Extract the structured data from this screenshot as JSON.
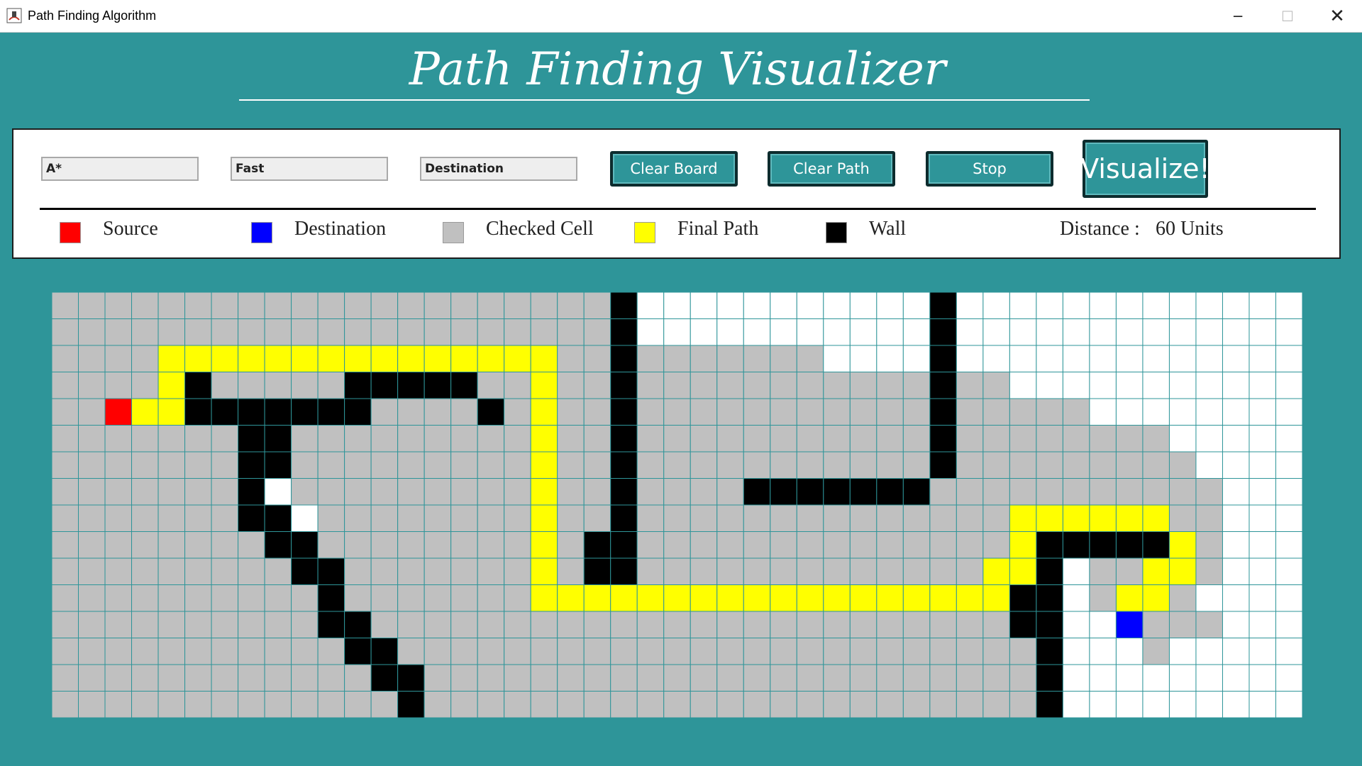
{
  "window": {
    "title": "Path Finding Algorithm",
    "controls": {
      "minimize": "─",
      "maximize": "☐",
      "close": "✕"
    }
  },
  "header": {
    "title": "Path Finding Visualizer"
  },
  "controls": {
    "algorithm": "A*",
    "speed": "Fast",
    "mode": "Destination",
    "clear_board": "Clear Board",
    "clear_path": "Clear Path",
    "stop": "Stop",
    "visualize": "Visualize!"
  },
  "legend": {
    "source": "Source",
    "destination": "Destination",
    "checked": "Checked Cell",
    "final_path": "Final Path",
    "wall": "Wall",
    "distance_label": "Distance :",
    "distance_value": "60 Units"
  },
  "colors": {
    "background": "#2e9599",
    "source": "#ff0000",
    "destination": "#0000ff",
    "checked": "#c0c0c0",
    "path": "#ffff00",
    "wall": "#000000",
    "empty": "#ffffff",
    "gridline": "#2e9599"
  },
  "grid": {
    "cols": 47,
    "rows": 16,
    "rows_data": [
      "CCCCCCCCCCCCCCCCCCCCCWEEEEEEEEEEEWEEEEEEEEEEEEEEE",
      "CCCCCCCCCCCCCCCCCCCCCWEEEEEEEEEEEWEEEEEEEEEEEEEEE",
      "CCCCPPPPPPPPPPPPPPPCCWCCCCCCCEEEEWEEEEEEEEEEEEEEE",
      "CCCCPWCCCCCWWWWWCCPCCWCCCCCCCCCCCWCCEEEEEEEEEEEEE",
      "CCSPPWWWWWWWCCCCWCPCCWCCCCCCCCCCCWCCCCCEEEEEEEEEE",
      "CCCCCCCWWCCCCCCCCCPCCWCCCCCCCCCCCWCCCCCCCCEEEEEEE",
      "CCCCCCCWWCCCCCCCCCPCCWCCCCCCCCCCCWCCCCCCCCCEEEEEE",
      "CCCCCCCWECCCCCCCCCPCCWCCCCWWWWWWWCCCCCCCCCCCEEEEE",
      "CCCCCCCWWECCCCCCCCPCCWCCCCCCCCCCCCCCPPPPPPCCEEEEE",
      "CCCCCCCCWWCCCCCCCCPCWWCCCCCCCCCCCCCCPWWWWWPCEEEEE",
      "CCCCCCCCCWWCCCCCCCPCWWCCCCCCCCCCCCCPPWECCPPCEEEEE",
      "CCCCCCCCCCWCCCCCCCPPPPPPPPPPPPPPPPPPWWECPPCEEEEEE",
      "CCCCCCCCCCWWCCCCCCCCCCCCCCCCCCCCCCCCWWEEDCCCEEEEE",
      "CCCCCCCCCCCWWCCCCCCCCCCCCCCCCCCCCCCCCWEEECEEEEEEE",
      "CCCCCCCCCCCCWWCCCCCCCCCCCCCCCCCCCCCCCWEEEEEEEEEEE",
      "CCCCCCCCCCCCCWCCCCCCCCCCCCCCCCCCCCCCCWEEEEEEEEEEE"
    ]
  }
}
